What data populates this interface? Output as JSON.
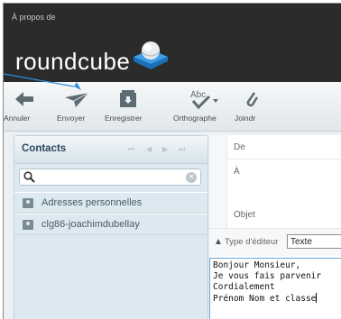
{
  "window": {
    "title": "À propos de"
  },
  "brand": {
    "logo_text": "roundcube"
  },
  "toolbar": {
    "cancel_label": "Annuler",
    "send_label": "Envoyer",
    "save_label": "Enregistrer",
    "spell_label": "Orthographe",
    "attach_label": "Joindr"
  },
  "contacts": {
    "title": "Contacts",
    "search_value": "",
    "address_books": [
      {
        "label": "Adresses personnelles"
      },
      {
        "label": "clg86-joachimdubellay"
      }
    ]
  },
  "compose": {
    "from_label": "De",
    "to_label": "À",
    "subject_label": "Objet",
    "editor_type_label": "Type d'éditeur",
    "editor_type_value": "Texte",
    "body_lines": [
      "Bonjour Monsieur,",
      "Je vous fais parvenir",
      "Cordialement",
      "Prénom Nom et classe"
    ]
  },
  "colors": {
    "topbar": "#2b2b2b",
    "accent_blue": "#2f8fd8",
    "contacts_bg": "#dce9f0"
  }
}
